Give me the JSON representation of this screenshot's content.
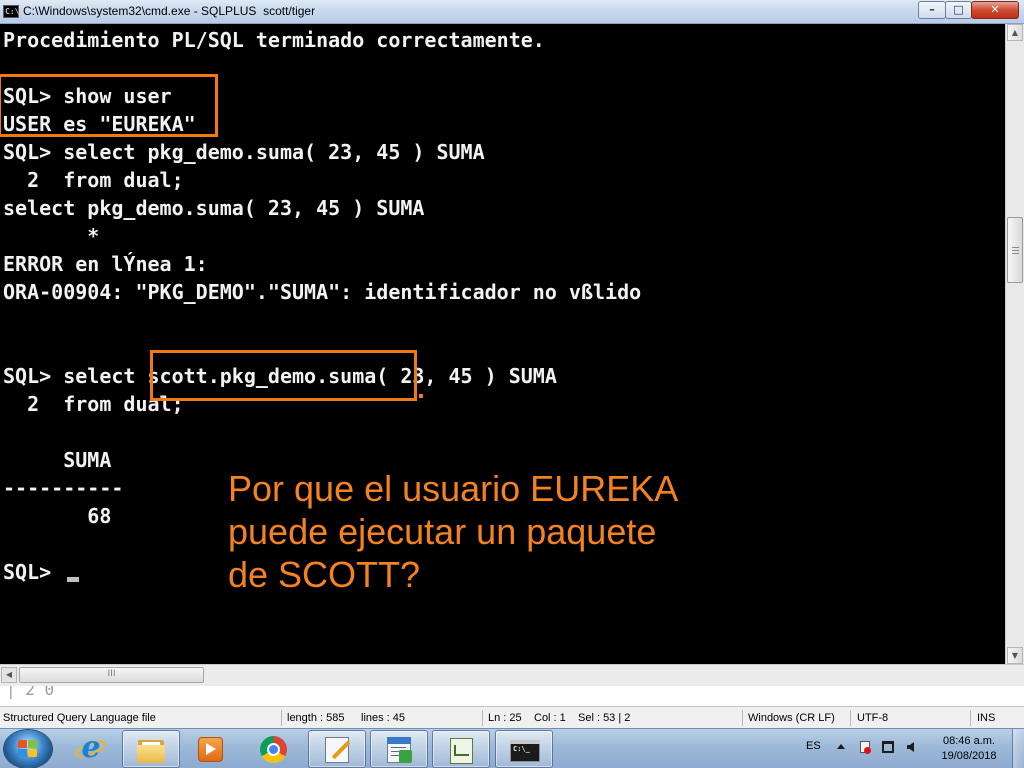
{
  "window": {
    "title": "C:\\Windows\\system32\\cmd.exe - SQLPLUS  scott/tiger",
    "icon_name": "cmd-window-icon",
    "buttons": {
      "minimize": "–",
      "maximize": "□",
      "close": "✕"
    }
  },
  "console": {
    "foreground": "#f2f2f2",
    "background": "#000000",
    "lines": [
      "Procedimiento PL/SQL terminado correctamente.",
      "",
      "SQL> show user",
      "USER es \"EUREKA\"",
      "SQL> select pkg_demo.suma( 23, 45 ) SUMA",
      "  2  from dual;",
      "select pkg_demo.suma( 23, 45 ) SUMA",
      "       *",
      "ERROR en lÝnea 1:",
      "ORA-00904: \"PKG_DEMO\".\"SUMA\": identificador no vßlido",
      "",
      "",
      "SQL> select scott.pkg_demo.suma( 23, 45 ) SUMA",
      "  2  from dual;",
      "",
      "     SUMA",
      "----------",
      "       68",
      "",
      "SQL> "
    ],
    "annotation": "Por que el usuario EUREKA\npuede ejecutar un paquete\nde SCOTT?",
    "highlight_color": "#f07a12",
    "annotation_color": "#f58220"
  },
  "editor": {
    "hscroll_thumb_label": "III",
    "ruler_fragment": "│ 2 0",
    "status": {
      "file_type": "Structured Query Language file",
      "length": "length : 585",
      "lines": "lines : 45",
      "ln": "Ln : 25",
      "col": "Col : 1",
      "sel": "Sel : 53 | 2",
      "eol": "Windows (CR LF)",
      "encoding": "UTF-8",
      "mode": "INS"
    }
  },
  "taskbar": {
    "buttons": [
      {
        "name": "internet-explorer",
        "icon": "ie-icon"
      },
      {
        "name": "windows-explorer",
        "icon": "folder-icon"
      },
      {
        "name": "media-player",
        "icon": "media-player-icon"
      },
      {
        "name": "google-chrome",
        "icon": "chrome-icon"
      },
      {
        "name": "sql-developer",
        "icon": "sql-editor-icon"
      },
      {
        "name": "sql-tool",
        "icon": "sql-tool-icon"
      },
      {
        "name": "notepad-plus-plus",
        "icon": "notepad-plus-plus-icon"
      },
      {
        "name": "command-prompt",
        "icon": "cmd-icon"
      }
    ],
    "cmd_icon_text": "C:\\_",
    "tray": {
      "language": "ES",
      "time": "08:46 a.m.",
      "date": "19/08/2018"
    }
  }
}
